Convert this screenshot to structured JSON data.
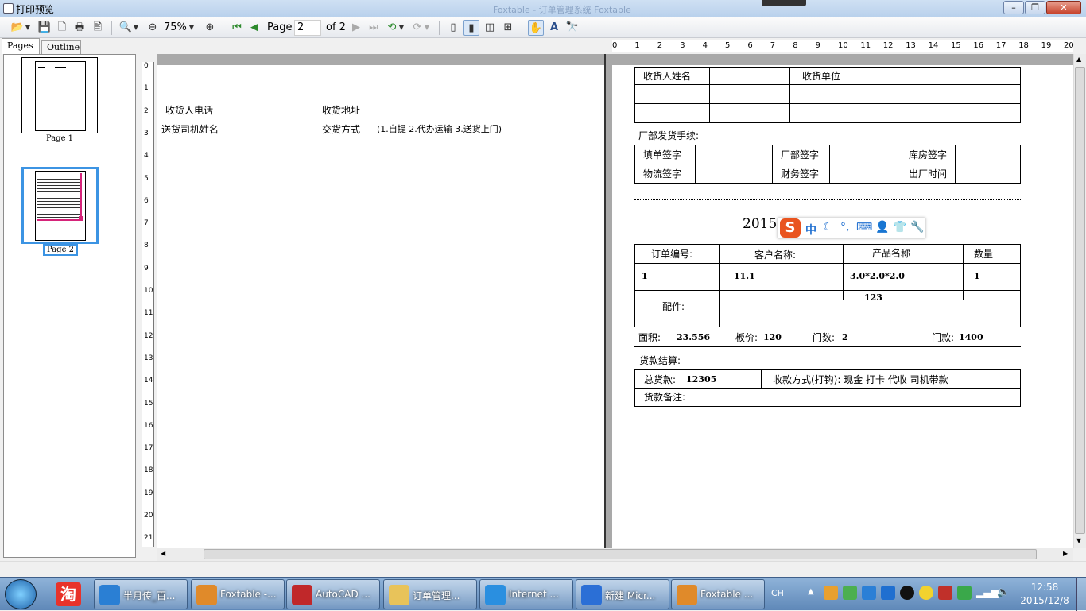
{
  "window": {
    "title": "打印预览",
    "title_bg_faint": "Foxtable - 订单管理系统 Foxtable"
  },
  "toolbar": {
    "zoom": "75%",
    "page_label": "Page",
    "page_value": "2",
    "of_label": "of 2"
  },
  "tabs": {
    "pages": "Pages",
    "outline": "Outline"
  },
  "thumbnails": [
    {
      "label": "Page 1"
    },
    {
      "label": "Page 2"
    }
  ],
  "ruler_h": [
    "0",
    "1",
    "2",
    "3",
    "4",
    "5",
    "6",
    "7",
    "8",
    "9",
    "10",
    "11",
    "12",
    "13",
    "14",
    "15",
    "16",
    "17",
    "18",
    "19",
    "20"
  ],
  "ruler_v": [
    "0",
    "1",
    "2",
    "3",
    "4",
    "5",
    "6",
    "7",
    "8",
    "9",
    "10",
    "11",
    "12",
    "13",
    "14",
    "15",
    "16",
    "17",
    "18",
    "19",
    "20",
    "21"
  ],
  "page1": {
    "receiver_phone": "收货人电话",
    "receiver_address": "收货地址",
    "driver_name": "送货司机姓名",
    "delivery_method": "交货方式",
    "delivery_options": "(1.自提 2.代办运输 3.送货上门)"
  },
  "page2": {
    "receiver_name": "收货人姓名",
    "receiver_unit": "收货单位",
    "factory_procedure": "厂部发货手续:",
    "sig_filler": "填单签字",
    "sig_factory": "厂部签字",
    "sig_warehouse": "库房签字",
    "sig_logistics": "物流签字",
    "sig_finance": "财务签字",
    "out_time": "出厂时间",
    "heading_partial": "2015",
    "col_order_no": "订单编号:",
    "col_customer": "客户名称:",
    "col_product": "产品名称",
    "col_qty": "数量",
    "row_order_no": "1",
    "row_customer": "11.1",
    "row_product": "3.0*2.0*2.0",
    "row_product2": "123",
    "row_qty": "1",
    "accessories": "配件:",
    "area_label": "面积:",
    "area_value": "23.556",
    "board_price_label": "板价:",
    "board_price_value": "120",
    "door_count_label": "门数:",
    "door_count_value": "2",
    "door_amount_label": "门款:",
    "door_amount_value": "1400",
    "payment_settle": "货款结算:",
    "total_label": "总货款:",
    "total_value": "12305",
    "pay_method": "收款方式(打钩): 现金 打卡 代收 司机带款",
    "remarks": "货款备注:"
  },
  "ime": {
    "mode": "中"
  },
  "taskbar": {
    "items": [
      {
        "label": "半月传_百...",
        "color": "#2a7fd4"
      },
      {
        "label": "Foxtable -...",
        "color": "#e08a2a"
      },
      {
        "label": "AutoCAD ...",
        "color": "#c0282a"
      },
      {
        "label": "订单管理...",
        "color": "#e8c35a"
      },
      {
        "label": "Internet ...",
        "color": "#2a8fe0"
      },
      {
        "label": "新建 Micr...",
        "color": "#2b6fd6"
      },
      {
        "label": "Foxtable ...",
        "color": "#e08a2a"
      }
    ],
    "lang": "CH",
    "time": "12:58",
    "date": "2015/12/8"
  }
}
